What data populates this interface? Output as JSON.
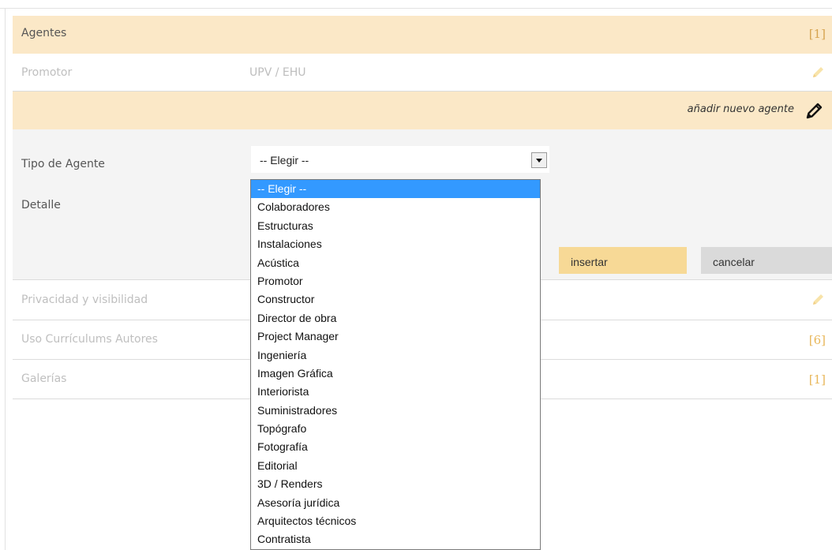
{
  "sections": {
    "agentes": {
      "label": "Agentes",
      "count": "[1]"
    },
    "promotor": {
      "label": "Promotor",
      "value": "UPV / EHU"
    },
    "add_agent_link": "añadir nuevo agente",
    "form": {
      "tipo_label": "Tipo de Agente",
      "detalle_label": "Detalle",
      "select_value": "-- Elegir --",
      "insert_label": "insertar",
      "cancel_label": "cancelar"
    },
    "privacidad": {
      "label": "Privacidad y visibilidad"
    },
    "uso": {
      "label": "Uso Currículums Autores",
      "count": "[6]"
    },
    "galerias": {
      "label": "Galerías",
      "count": "[1]"
    }
  },
  "dropdown_options": [
    "-- Elegir --",
    "Colaboradores",
    "Estructuras",
    "Instalaciones",
    "Acústica",
    "Promotor",
    "Constructor",
    "Director de obra",
    "Project Manager",
    "Ingeniería",
    "Imagen Gráfica",
    "Interiorista",
    "Suministradores",
    "Topógrafo",
    "Fotografía",
    "Editorial",
    "3D / Renders",
    "Asesoría jurídica",
    "Arquitectos técnicos",
    "Contratista"
  ],
  "colors": {
    "section_bg": "#fbe8c7",
    "accent_button": "#f7d996",
    "count_color": "#e8b75a",
    "selected_option": "#3399ff"
  },
  "icons": {
    "edit": "pencil-icon",
    "select_arrow": "chevron-down-icon"
  }
}
